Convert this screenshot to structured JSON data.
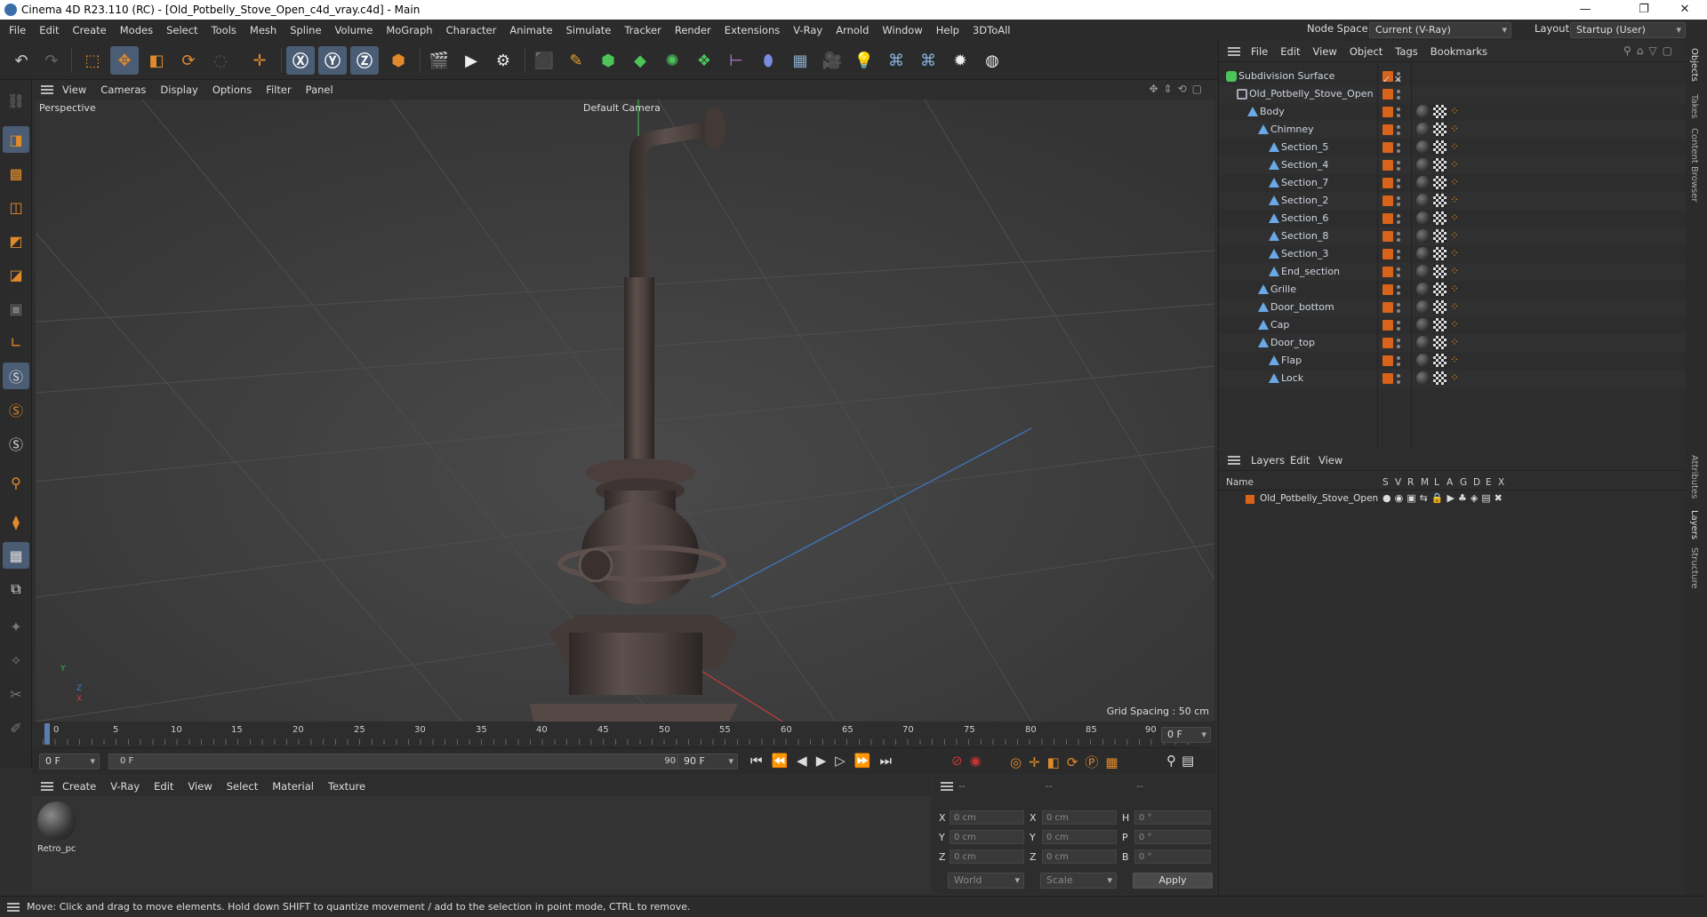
{
  "window": {
    "title": "Cinema 4D R23.110 (RC) - [Old_Potbelly_Stove_Open_c4d_vray.c4d] - Main",
    "minimize": "—",
    "maximize": "❐",
    "close": "✕"
  },
  "menubar": {
    "items": [
      "File",
      "Edit",
      "Create",
      "Modes",
      "Select",
      "Tools",
      "Mesh",
      "Spline",
      "Volume",
      "MoGraph",
      "Character",
      "Animate",
      "Simulate",
      "Tracker",
      "Render",
      "Extensions",
      "V-Ray",
      "Arnold",
      "Window",
      "Help",
      "3DToAll"
    ],
    "node_space_label": "Node Space:",
    "node_space_value": "Current (V-Ray)",
    "layout_label": "Layout:",
    "layout_value": "Startup (User)"
  },
  "viewport": {
    "menu": [
      "View",
      "Cameras",
      "Display",
      "Options",
      "Filter",
      "Panel"
    ],
    "label": "Perspective",
    "camera": "Default Camera",
    "grid_spacing": "Grid Spacing : 50 cm",
    "axis_y": "Y",
    "axis_z": "Z",
    "axis_x": "X"
  },
  "timeline": {
    "ticks": [
      "0",
      "5",
      "10",
      "15",
      "20",
      "25",
      "30",
      "35",
      "40",
      "45",
      "50",
      "55",
      "60",
      "65",
      "70",
      "75",
      "80",
      "85",
      "90"
    ],
    "current_frame": "0 F",
    "start_frame": "0 F",
    "range_start": "0 F",
    "range_end": "90 F",
    "end_frame": "90 F"
  },
  "material": {
    "menu": [
      "Create",
      "V-Ray",
      "Edit",
      "View",
      "Select",
      "Material",
      "Texture"
    ],
    "items": [
      {
        "name": "Retro_pc"
      }
    ]
  },
  "coords": {
    "headers": [
      "--",
      "--",
      "--"
    ],
    "rows": [
      {
        "a": "X",
        "av": "0 cm",
        "b": "X",
        "bv": "0 cm",
        "c": "H",
        "cv": "0 °"
      },
      {
        "a": "Y",
        "av": "0 cm",
        "b": "Y",
        "bv": "0 cm",
        "c": "P",
        "cv": "0 °"
      },
      {
        "a": "Z",
        "av": "0 cm",
        "b": "Z",
        "bv": "0 cm",
        "c": "B",
        "cv": "0 °"
      }
    ],
    "space": "World",
    "mode": "Scale",
    "apply": "Apply"
  },
  "objects": {
    "menu": [
      "File",
      "Edit",
      "View",
      "Object",
      "Tags",
      "Bookmarks"
    ],
    "tree": [
      {
        "name": "Subdivision Surface",
        "depth": 0,
        "kind": "subdiv"
      },
      {
        "name": "Old_Potbelly_Stove_Open",
        "depth": 1,
        "kind": "null"
      },
      {
        "name": "Body",
        "depth": 2,
        "kind": "poly"
      },
      {
        "name": "Chimney",
        "depth": 3,
        "kind": "poly"
      },
      {
        "name": "Section_5",
        "depth": 4,
        "kind": "poly"
      },
      {
        "name": "Section_4",
        "depth": 4,
        "kind": "poly"
      },
      {
        "name": "Section_7",
        "depth": 4,
        "kind": "poly"
      },
      {
        "name": "Section_2",
        "depth": 4,
        "kind": "poly"
      },
      {
        "name": "Section_6",
        "depth": 4,
        "kind": "poly"
      },
      {
        "name": "Section_8",
        "depth": 4,
        "kind": "poly"
      },
      {
        "name": "Section_3",
        "depth": 4,
        "kind": "poly"
      },
      {
        "name": "End_section",
        "depth": 4,
        "kind": "poly"
      },
      {
        "name": "Grille",
        "depth": 3,
        "kind": "poly"
      },
      {
        "name": "Door_bottom",
        "depth": 3,
        "kind": "poly"
      },
      {
        "name": "Cap",
        "depth": 3,
        "kind": "poly"
      },
      {
        "name": "Door_top",
        "depth": 3,
        "kind": "poly"
      },
      {
        "name": "Flap",
        "depth": 4,
        "kind": "poly"
      },
      {
        "name": "Lock",
        "depth": 4,
        "kind": "poly"
      }
    ]
  },
  "layers": {
    "menu": [
      "Layers",
      "Edit",
      "View"
    ],
    "columns": [
      "Name",
      "S",
      "V",
      "R",
      "M",
      "L",
      "A",
      "G",
      "D",
      "E",
      "X"
    ],
    "items": [
      {
        "name": "Old_Potbelly_Stove_Open"
      }
    ]
  },
  "right_tabs": [
    "Objects",
    "Takes",
    "Content Browser",
    "Attributes",
    "Layers",
    "Structure"
  ],
  "status": "Move: Click and drag to move elements. Hold down SHIFT to quantize movement / add to the selection in point mode, CTRL to remove.",
  "colors": {
    "accent": "#4b5d74",
    "orange": "#d8631b",
    "grid_blue": "#3d7cc9",
    "grid_red": "#c73c3c",
    "grid_green": "#3fb34f"
  }
}
